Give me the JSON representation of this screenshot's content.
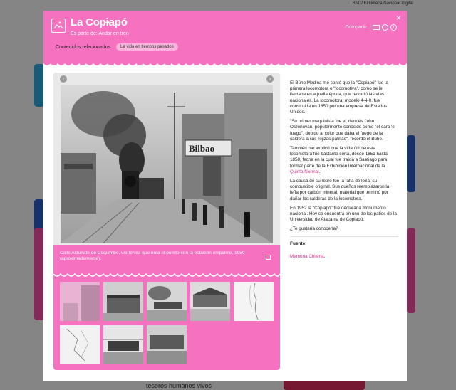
{
  "background": {
    "topbar_text": "BND/ Biblioteca Nacional Digital",
    "bottom_banner": "tesoros humanos vivos"
  },
  "modal": {
    "title": "La Copiapó",
    "subtitle_prefix": "Es parte de:",
    "subtitle_link": "Andar en tren",
    "share_label": "Compartir:",
    "close_label": "×",
    "related_label": "Contenidos relacionados:",
    "related_tag": "La vida en tiempos pasados",
    "colors": {
      "accent": "#f672c1",
      "link": "#e0348f"
    }
  },
  "gallery": {
    "caption": "Calle Aldunate de Coquimbo, vía férrea que unía el puerto con la estación empalme, 1950 (aproximadamente).",
    "sign_text": "Bilbao"
  },
  "article": {
    "p1": "El Búho Medina me contó que la \"Copiapó\" fue la primera locomotora o \"locomotiva\", como se le llamaba en aquella época, que recorrió las vías nacionales. La locomotora, modelo 4-4-0, fue construida en 1850 por una empresa de Estados Unidos.",
    "p2": "\"Su primer maquinista fue el irlandés John O'Donovan, popularmente conocido como \"el cara 'e fuego\", debido al color que daba el fuego de la caldera a sus rojizas patillas\", recordó el Búho.",
    "p3_pre": "También me explicó que la vida útil de esta locomotora fue bastante corta, desde 1851 hasta 1858, fecha en la cual fue traída a Santiago para formar parte de la Exhibición Internacional de la ",
    "p3_link": "Quinta Normal",
    "p3_post": ".",
    "p4": "La causa de su retiro fue la falta de leña, su combustible original. Sus dueños reemplazaron la leña por carbón mineral, material que terminó por dañar las calderas de la locomotora.",
    "p5": "En 1952 la \"Copiapó\" fue declarada monumento nacional. Hoy se encuentra en uno de los patios de la Universidad de Atacama de Copiapó.",
    "p6": "¿Te gustaría conocerla?",
    "source_label": "Fuente:",
    "source_link": "Memoria Chilena",
    "source_post": "."
  }
}
